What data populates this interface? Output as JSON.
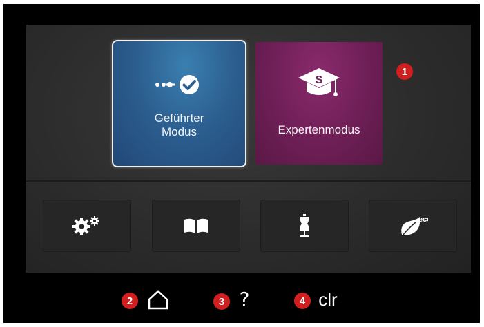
{
  "modes": {
    "guided": {
      "label": "Geführter\nModus",
      "icon": "guided-steps-check-icon",
      "color": "#2b5d8e"
    },
    "expert": {
      "label": "Expertenmodus",
      "icon": "graduation-cap-icon",
      "color": "#6e1f56"
    }
  },
  "function_buttons": [
    {
      "name": "settings-button",
      "icon": "gears-icon"
    },
    {
      "name": "tutorial-button",
      "icon": "open-book-icon"
    },
    {
      "name": "sewing-consultant-button",
      "icon": "dress-form-icon"
    },
    {
      "name": "eco-mode-button",
      "icon": "eco-leaf-icon",
      "label": "eco"
    }
  ],
  "system_bar": {
    "home": {
      "icon": "home-icon"
    },
    "help": {
      "icon": "help-icon",
      "label": "?"
    },
    "clear": {
      "icon": "clear-icon",
      "label": "clr"
    }
  },
  "callouts": [
    "1",
    "2",
    "3",
    "4"
  ],
  "colors": {
    "callout": "#d11f1f",
    "screen": "#2c2c2c",
    "bezel": "#000000"
  }
}
